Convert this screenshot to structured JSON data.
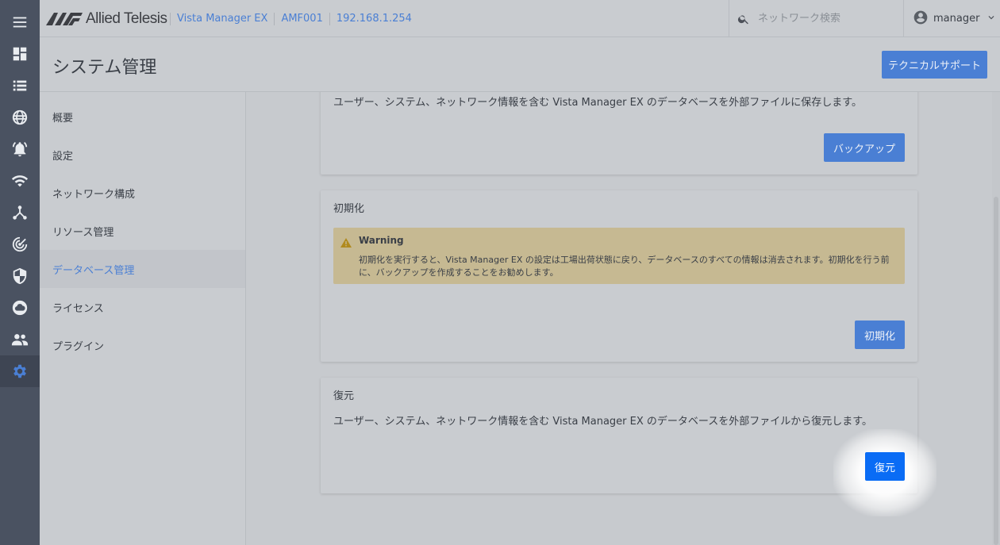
{
  "brand": {
    "name": "Allied Telesis",
    "logo_color": "#3d3f44"
  },
  "breadcrumb": [
    "Vista Manager EX",
    "AMF001",
    "192.168.1.254"
  ],
  "search": {
    "placeholder": "ネットワーク検索",
    "value": ""
  },
  "user": {
    "name": "manager"
  },
  "page": {
    "title": "システム管理",
    "tech_support_label": "テクニカルサポート"
  },
  "rail": {
    "icons": [
      "menu-icon",
      "dashboard-icon",
      "list-icon",
      "globe-icon",
      "alarm-icon",
      "wifi-icon",
      "topology-icon",
      "radar-icon",
      "shield-icon",
      "cloud-icon",
      "users-icon",
      "gear-icon"
    ],
    "active": "gear-icon"
  },
  "subnav": {
    "items": [
      "概要",
      "設定",
      "ネットワーク構成",
      "リソース管理",
      "データベース管理",
      "ライセンス",
      "プラグイン"
    ],
    "active_index": 4
  },
  "backup": {
    "description": "ユーザー、システム、ネットワーク情報を含む Vista Manager EX のデータベースを外部ファイルに保存します。",
    "button": "バックアップ"
  },
  "reset": {
    "title": "初期化",
    "warning_title": "Warning",
    "warning_body": "初期化を実行すると、Vista Manager EX の設定は工場出荷状態に戻り、データベースのすべての情報は消去されます。初期化を行う前に、バックアップを作成することをお勧めします。",
    "button": "初期化"
  },
  "restore": {
    "title": "復元",
    "description": "ユーザー、システム、ネットワーク情報を含む Vista Manager EX のデータベースを外部ファイルから復元します。",
    "button": "復元"
  },
  "colors": {
    "accent": "#4a7fd4",
    "primary_button": "#0a6cf5",
    "rail_bg": "#4a5261",
    "warning_bg": "#c6b992"
  }
}
